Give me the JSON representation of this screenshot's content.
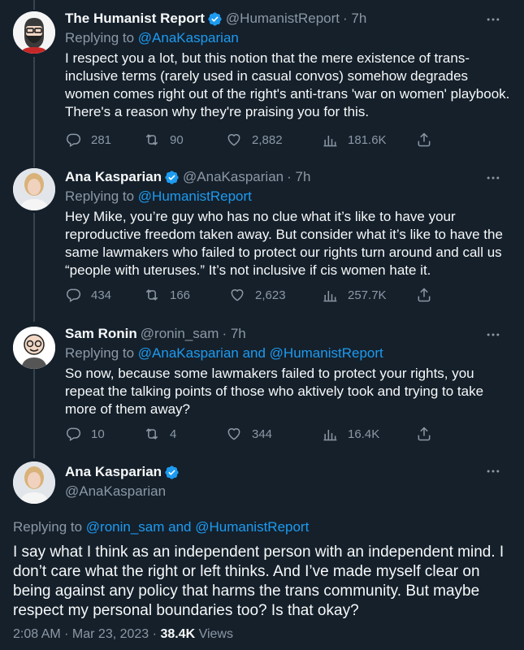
{
  "tweets": [
    {
      "name": "The Humanist Report",
      "handle": "@HumanistReport",
      "time": "· 7h",
      "reply_prefix": "Replying to",
      "reply_to": "@AnaKasparian",
      "text": "I respect you a lot, but this notion that the mere existence of trans-inclusive terms (rarely used in casual convos) somehow degrades women comes right out of the right's anti-trans 'war on women' playbook. There's a reason why they're praising you for this.",
      "replies": "281",
      "retweets": "90",
      "likes": "2,882",
      "views": "181.6K"
    },
    {
      "name": "Ana Kasparian",
      "handle": "@AnaKasparian",
      "time": "· 7h",
      "reply_prefix": "Replying to",
      "reply_to": "@HumanistReport",
      "text": "Hey Mike, you’re guy who has no clue what it’s like to have your reproductive freedom taken away. But consider what it’s like to have the same lawmakers who failed to protect our rights turn around and call us “people with uteruses.” It’s not inclusive if cis women hate it.",
      "replies": "434",
      "retweets": "166",
      "likes": "2,623",
      "views": "257.7K"
    },
    {
      "name": "Sam Ronin",
      "handle": "@ronin_sam",
      "time": "· 7h",
      "reply_prefix": "Replying to",
      "reply_to": "@AnaKasparian and @HumanistReport",
      "text": "So now, because some lawmakers failed to protect your rights, you repeat the talking points of those who aktively took and trying to take more of them away?",
      "replies": "10",
      "retweets": "4",
      "likes": "344",
      "views": "16.4K"
    }
  ],
  "main_tweet": {
    "name": "Ana Kasparian",
    "handle": "@AnaKasparian",
    "reply_prefix": "Replying to",
    "reply_to": "@ronin_sam and @HumanistReport",
    "text": "I say what I think as an independent person with an independent mind. I don’t care what the right or left thinks. And I’ve made myself clear on being against any policy that harms the trans community. But maybe respect my personal boundaries too? Is that okay?",
    "timestamp": "2:08 AM · Mar 23, 2023 ·",
    "views_count": "38.4K",
    "views_label": "Views"
  },
  "colors": {
    "background": "#15202b",
    "accent": "#1d9bf0",
    "secondary_text": "#8b98a5"
  },
  "icons": [
    "verified-badge-icon",
    "more-icon",
    "reply-icon",
    "retweet-icon",
    "like-icon",
    "views-icon",
    "share-icon"
  ]
}
